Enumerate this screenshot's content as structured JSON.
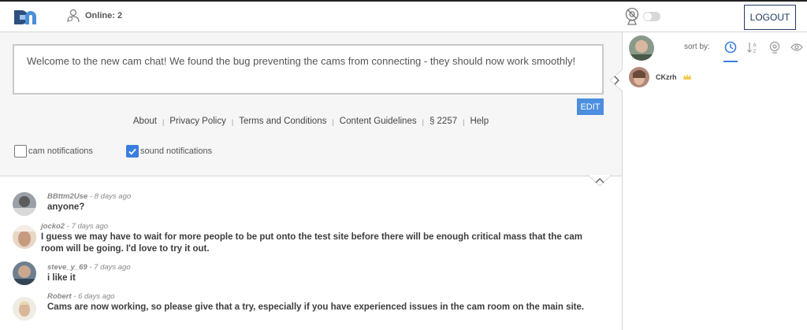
{
  "header": {
    "logo_text": "Dn",
    "online_label": "Online: 2",
    "logout_label": "LOGOUT"
  },
  "welcome": {
    "message": "Welcome to the new cam chat! We found the bug preventing the cams from connecting - they should now work smoothly!",
    "edit_label": "EDIT"
  },
  "footer": {
    "links": [
      "About",
      "Privacy Policy",
      "Terms and Conditions",
      "Content Guidelines",
      "§ 2257",
      "Help"
    ],
    "separator": "|"
  },
  "notifications": {
    "cam_label": "cam notifications",
    "cam_checked": false,
    "sound_label": "sound notifications",
    "sound_checked": true
  },
  "messages": [
    {
      "author": "BBttm2Use",
      "time": "8 days ago",
      "text": "anyone?"
    },
    {
      "author": "jocko2",
      "time": "7 days ago",
      "text": "I guess we may have to wait for more people to be put onto the test site before there will be enough critical mass that the cam room will be going. I'd love to try it out."
    },
    {
      "author": "steve_y_69",
      "time": "7 days ago",
      "text": "i like it"
    },
    {
      "author": "Robert",
      "time": "6 days ago",
      "text": "Cams are now working, so please give that a try, especially if you have experienced issues in the cam room on the main site."
    }
  ],
  "sidebar": {
    "sort_label": "sort by:",
    "sort_options": [
      "clock-icon",
      "sort-alpha-icon",
      "webcam-icon",
      "eye-icon"
    ],
    "users": [
      {
        "name": "CKzrh",
        "badge": "crown-icon"
      }
    ]
  },
  "colors": {
    "accent": "#3a7de0",
    "logout_border": "#1f3b66",
    "edit_button": "#4c8fe0",
    "panel_bg": "#f6f6f6",
    "crown": "#f2c94c"
  }
}
